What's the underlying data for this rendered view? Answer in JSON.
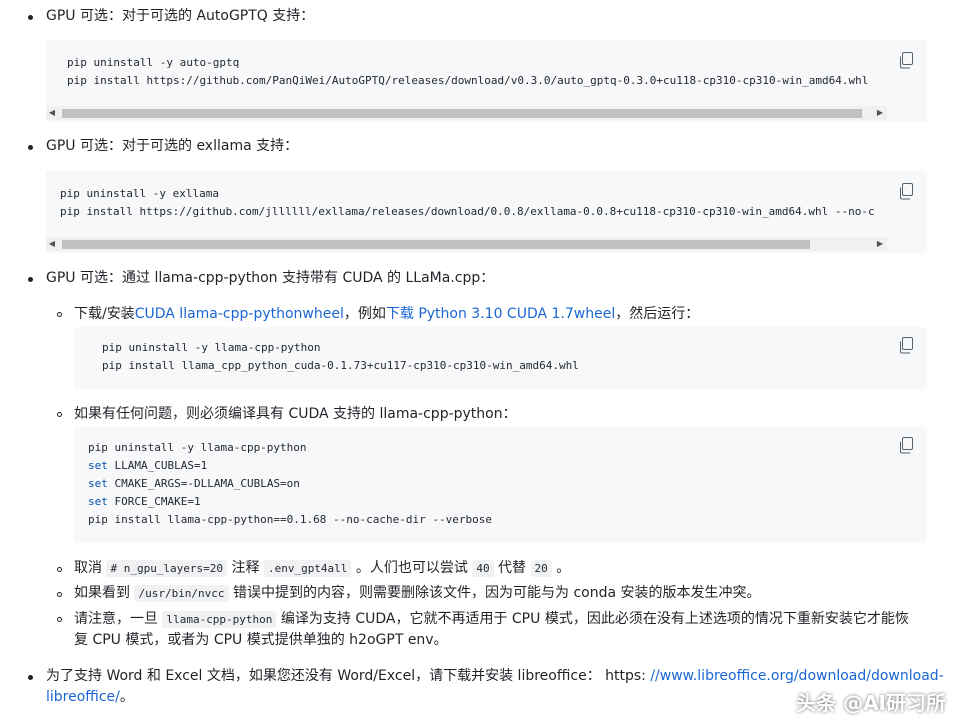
{
  "sections": {
    "s1": {
      "label": "GPU 可选：对于可选的 AutoGPTQ 支持：",
      "code": [
        "pip uninstall -y auto-gptq",
        "pip install https://github.com/PanQiWei/AutoGPTQ/releases/download/v0.3.0/auto_gptq-0.3.0+cu118-cp310-cp310-win_amd64.whl"
      ]
    },
    "s2": {
      "label": "GPU 可选：对于可选的 exllama 支持：",
      "code": [
        "pip uninstall -y exllama",
        "pip install https://github.com/jllllll/exllama/releases/download/0.0.8/exllama-0.0.8+cu118-cp310-cp310-win_amd64.whl --no-c"
      ]
    },
    "s3": {
      "label": "GPU 可选：通过 llama-cpp-python 支持带有 CUDA 的 LLaMa.cpp："
    },
    "s3a": {
      "prefix": "下载/安装",
      "link1": "CUDA llama-cpp-pythonwheel",
      "mid": "，例如",
      "link2": "下载 Python 3.10 CUDA 1.7wheel",
      "suffix": "，然后运行：",
      "code": [
        "pip uninstall -y llama-cpp-python",
        "pip install llama_cpp_python_cuda-0.1.73+cu117-cp310-cp310-win_amd64.whl"
      ]
    },
    "s3b": {
      "label": "如果有任何问题，则必须编译具有 CUDA 支持的 llama-cpp-python：",
      "code": {
        "l1": "pip uninstall -y llama-cpp-python",
        "l2kw": "set",
        "l2": " LLAMA_CUBLAS=1",
        "l3kw": "set",
        "l3": " CMAKE_ARGS=-DLLAMA_CUBLAS=on",
        "l4kw": "set",
        "l4": " FORCE_CMAKE=1",
        "l5": "pip install llama-cpp-python==0.1.68 --no-cache-dir --verbose"
      }
    },
    "s3c": {
      "t1": "取消 ",
      "c1": "# n_gpu_layers=20",
      "t2": " 注释 ",
      "c2": ".env_gpt4all",
      "t3": " 。人们也可以尝试 ",
      "c3": "40",
      "t4": " 代替 ",
      "c4": "20",
      "t5": " 。"
    },
    "s3d": {
      "t1": "如果看到 ",
      "c1": "/usr/bin/nvcc",
      "t2": " 错误中提到的内容，则需要删除该文件，因为可能与为 conda 安装的版本发生冲突。"
    },
    "s3e": {
      "t1": "请注意，一旦 ",
      "c1": "llama-cpp-python",
      "t2": " 编译为支持 CUDA，它就不再适用于 CPU 模式，因此必须在没有上述选项的情况下重新安装它才能恢",
      "t3": "复 CPU 模式，或者为 CPU 模式提供单独的 h2oGPT env。"
    },
    "s4": {
      "t1": "为了支持 Word 和 Excel 文档，如果您还没有 Word/Excel，请下载并安装 libreoffice：  https: ",
      "link": "//www.libreoffice.org/download/download-",
      "link2": "libreoffice/",
      "t2": "。"
    }
  },
  "copy_icon": "copy-icon",
  "watermark": "头条 @AI研习所",
  "colors": {
    "link": "#1a66d3",
    "code_bg": "#f6f8fa",
    "keyword": "#0550ae"
  }
}
